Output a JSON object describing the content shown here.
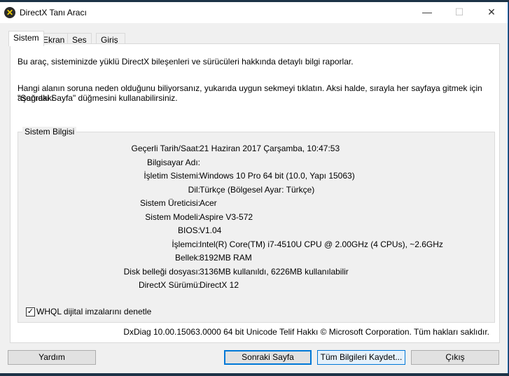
{
  "window": {
    "title": "DirectX Tanı Aracı",
    "minimize": "—",
    "maximize": "☐",
    "close": "✕"
  },
  "tabs": [
    "Sistem",
    "Ekran",
    "Ses",
    "Giriş"
  ],
  "intro": "Bu araç, sisteminizde yüklü DirectX bileşenleri ve sürücüleri hakkında detaylı bilgi raporlar.",
  "help_text_1": "Hangi alanın soruna neden olduğunu biliyorsanız, yukarıda uygun sekmeyi tıklatın. Aksi halde, sırayla her sayfaya gitmek için aşağıdaki",
  "help_text_2": "\"Sonraki Sayfa\" düğmesini kullanabilirsiniz.",
  "group_title": "Sistem Bilgisi",
  "rows": [
    {
      "k": "Geçerli Tarih/Saat:",
      "v": "21 Haziran 2017 Çarşamba, 10:47:53"
    },
    {
      "k": "Bilgisayar Adı:",
      "v": ""
    },
    {
      "k": "İşletim Sistemi:",
      "v": "Windows 10 Pro 64 bit (10.0, Yapı 15063)"
    },
    {
      "k": "Dil:",
      "v": "Türkçe (Bölgesel Ayar: Türkçe)"
    },
    {
      "k": "Sistem Üreticisi:",
      "v": "Acer"
    },
    {
      "k": "Sistem Modeli:",
      "v": "Aspire V3-572"
    },
    {
      "k": "BIOS:",
      "v": "V1.04"
    },
    {
      "k": "İşlemci:",
      "v": "Intel(R) Core(TM) i7-4510U CPU @ 2.00GHz (4 CPUs), ~2.6GHz"
    },
    {
      "k": "Bellek:",
      "v": "8192MB RAM"
    },
    {
      "k": "Disk belleği dosyası:",
      "v": "3136MB kullanıldı, 6226MB kullanılabilir"
    },
    {
      "k": "DirectX Sürümü:",
      "v": "DirectX 12"
    }
  ],
  "whql": {
    "label": "WHQL dijital imzalarını denetle",
    "checked": true
  },
  "copyright": "DxDiag 10.00.15063.0000 64 bit Unicode  Telif Hakkı © Microsoft Corporation. Tüm hakları saklıdır.",
  "buttons": {
    "help": "Yardım",
    "next": "Sonraki Sayfa",
    "save": "Tüm Bilgileri Kaydet...",
    "exit": "Çıkış"
  }
}
